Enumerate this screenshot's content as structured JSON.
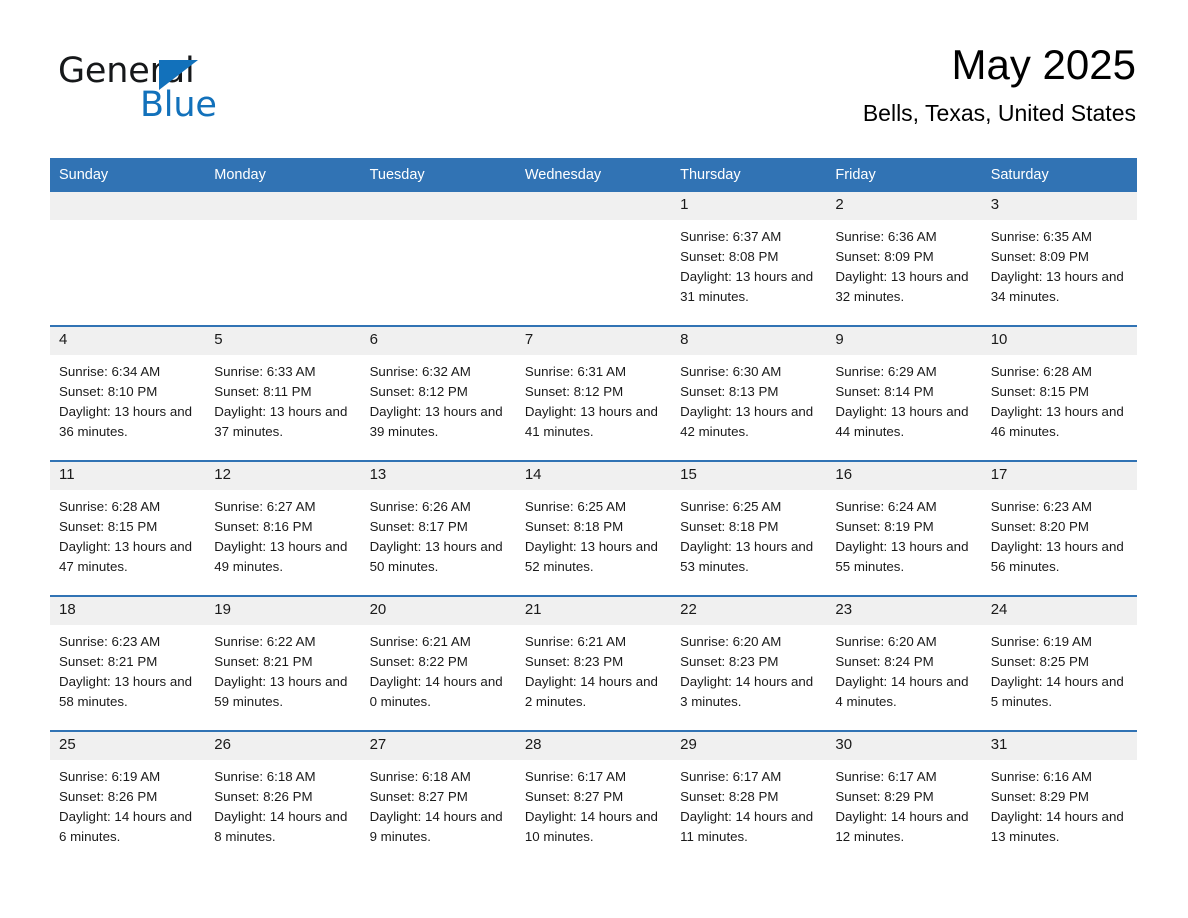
{
  "brand": {
    "line1": "General",
    "line2": "Blue",
    "triangle_color": "#1271BB",
    "text_color": "#16181a"
  },
  "header": {
    "title": "May 2025",
    "subtitle": "Bells, Texas, United States"
  },
  "theme": {
    "header_blue": "#3173B4",
    "daynum_band": "#F0F0F0",
    "page_background": "#FFFFFF",
    "text": "#1a1a1a"
  },
  "weekdays": [
    "Sunday",
    "Monday",
    "Tuesday",
    "Wednesday",
    "Thursday",
    "Friday",
    "Saturday"
  ],
  "weeks": [
    [
      {
        "empty": true
      },
      {
        "empty": true
      },
      {
        "empty": true
      },
      {
        "empty": true
      },
      {
        "day": "1",
        "sunrise": "Sunrise: 6:37 AM",
        "sunset": "Sunset: 8:08 PM",
        "daylight": "Daylight: 13 hours and 31 minutes."
      },
      {
        "day": "2",
        "sunrise": "Sunrise: 6:36 AM",
        "sunset": "Sunset: 8:09 PM",
        "daylight": "Daylight: 13 hours and 32 minutes."
      },
      {
        "day": "3",
        "sunrise": "Sunrise: 6:35 AM",
        "sunset": "Sunset: 8:09 PM",
        "daylight": "Daylight: 13 hours and 34 minutes."
      }
    ],
    [
      {
        "day": "4",
        "sunrise": "Sunrise: 6:34 AM",
        "sunset": "Sunset: 8:10 PM",
        "daylight": "Daylight: 13 hours and 36 minutes."
      },
      {
        "day": "5",
        "sunrise": "Sunrise: 6:33 AM",
        "sunset": "Sunset: 8:11 PM",
        "daylight": "Daylight: 13 hours and 37 minutes."
      },
      {
        "day": "6",
        "sunrise": "Sunrise: 6:32 AM",
        "sunset": "Sunset: 8:12 PM",
        "daylight": "Daylight: 13 hours and 39 minutes."
      },
      {
        "day": "7",
        "sunrise": "Sunrise: 6:31 AM",
        "sunset": "Sunset: 8:12 PM",
        "daylight": "Daylight: 13 hours and 41 minutes."
      },
      {
        "day": "8",
        "sunrise": "Sunrise: 6:30 AM",
        "sunset": "Sunset: 8:13 PM",
        "daylight": "Daylight: 13 hours and 42 minutes."
      },
      {
        "day": "9",
        "sunrise": "Sunrise: 6:29 AM",
        "sunset": "Sunset: 8:14 PM",
        "daylight": "Daylight: 13 hours and 44 minutes."
      },
      {
        "day": "10",
        "sunrise": "Sunrise: 6:28 AM",
        "sunset": "Sunset: 8:15 PM",
        "daylight": "Daylight: 13 hours and 46 minutes."
      }
    ],
    [
      {
        "day": "11",
        "sunrise": "Sunrise: 6:28 AM",
        "sunset": "Sunset: 8:15 PM",
        "daylight": "Daylight: 13 hours and 47 minutes."
      },
      {
        "day": "12",
        "sunrise": "Sunrise: 6:27 AM",
        "sunset": "Sunset: 8:16 PM",
        "daylight": "Daylight: 13 hours and 49 minutes."
      },
      {
        "day": "13",
        "sunrise": "Sunrise: 6:26 AM",
        "sunset": "Sunset: 8:17 PM",
        "daylight": "Daylight: 13 hours and 50 minutes."
      },
      {
        "day": "14",
        "sunrise": "Sunrise: 6:25 AM",
        "sunset": "Sunset: 8:18 PM",
        "daylight": "Daylight: 13 hours and 52 minutes."
      },
      {
        "day": "15",
        "sunrise": "Sunrise: 6:25 AM",
        "sunset": "Sunset: 8:18 PM",
        "daylight": "Daylight: 13 hours and 53 minutes."
      },
      {
        "day": "16",
        "sunrise": "Sunrise: 6:24 AM",
        "sunset": "Sunset: 8:19 PM",
        "daylight": "Daylight: 13 hours and 55 minutes."
      },
      {
        "day": "17",
        "sunrise": "Sunrise: 6:23 AM",
        "sunset": "Sunset: 8:20 PM",
        "daylight": "Daylight: 13 hours and 56 minutes."
      }
    ],
    [
      {
        "day": "18",
        "sunrise": "Sunrise: 6:23 AM",
        "sunset": "Sunset: 8:21 PM",
        "daylight": "Daylight: 13 hours and 58 minutes."
      },
      {
        "day": "19",
        "sunrise": "Sunrise: 6:22 AM",
        "sunset": "Sunset: 8:21 PM",
        "daylight": "Daylight: 13 hours and 59 minutes."
      },
      {
        "day": "20",
        "sunrise": "Sunrise: 6:21 AM",
        "sunset": "Sunset: 8:22 PM",
        "daylight": "Daylight: 14 hours and 0 minutes."
      },
      {
        "day": "21",
        "sunrise": "Sunrise: 6:21 AM",
        "sunset": "Sunset: 8:23 PM",
        "daylight": "Daylight: 14 hours and 2 minutes."
      },
      {
        "day": "22",
        "sunrise": "Sunrise: 6:20 AM",
        "sunset": "Sunset: 8:23 PM",
        "daylight": "Daylight: 14 hours and 3 minutes."
      },
      {
        "day": "23",
        "sunrise": "Sunrise: 6:20 AM",
        "sunset": "Sunset: 8:24 PM",
        "daylight": "Daylight: 14 hours and 4 minutes."
      },
      {
        "day": "24",
        "sunrise": "Sunrise: 6:19 AM",
        "sunset": "Sunset: 8:25 PM",
        "daylight": "Daylight: 14 hours and 5 minutes."
      }
    ],
    [
      {
        "day": "25",
        "sunrise": "Sunrise: 6:19 AM",
        "sunset": "Sunset: 8:26 PM",
        "daylight": "Daylight: 14 hours and 6 minutes."
      },
      {
        "day": "26",
        "sunrise": "Sunrise: 6:18 AM",
        "sunset": "Sunset: 8:26 PM",
        "daylight": "Daylight: 14 hours and 8 minutes."
      },
      {
        "day": "27",
        "sunrise": "Sunrise: 6:18 AM",
        "sunset": "Sunset: 8:27 PM",
        "daylight": "Daylight: 14 hours and 9 minutes."
      },
      {
        "day": "28",
        "sunrise": "Sunrise: 6:17 AM",
        "sunset": "Sunset: 8:27 PM",
        "daylight": "Daylight: 14 hours and 10 minutes."
      },
      {
        "day": "29",
        "sunrise": "Sunrise: 6:17 AM",
        "sunset": "Sunset: 8:28 PM",
        "daylight": "Daylight: 14 hours and 11 minutes."
      },
      {
        "day": "30",
        "sunrise": "Sunrise: 6:17 AM",
        "sunset": "Sunset: 8:29 PM",
        "daylight": "Daylight: 14 hours and 12 minutes."
      },
      {
        "day": "31",
        "sunrise": "Sunrise: 6:16 AM",
        "sunset": "Sunset: 8:29 PM",
        "daylight": "Daylight: 14 hours and 13 minutes."
      }
    ]
  ]
}
